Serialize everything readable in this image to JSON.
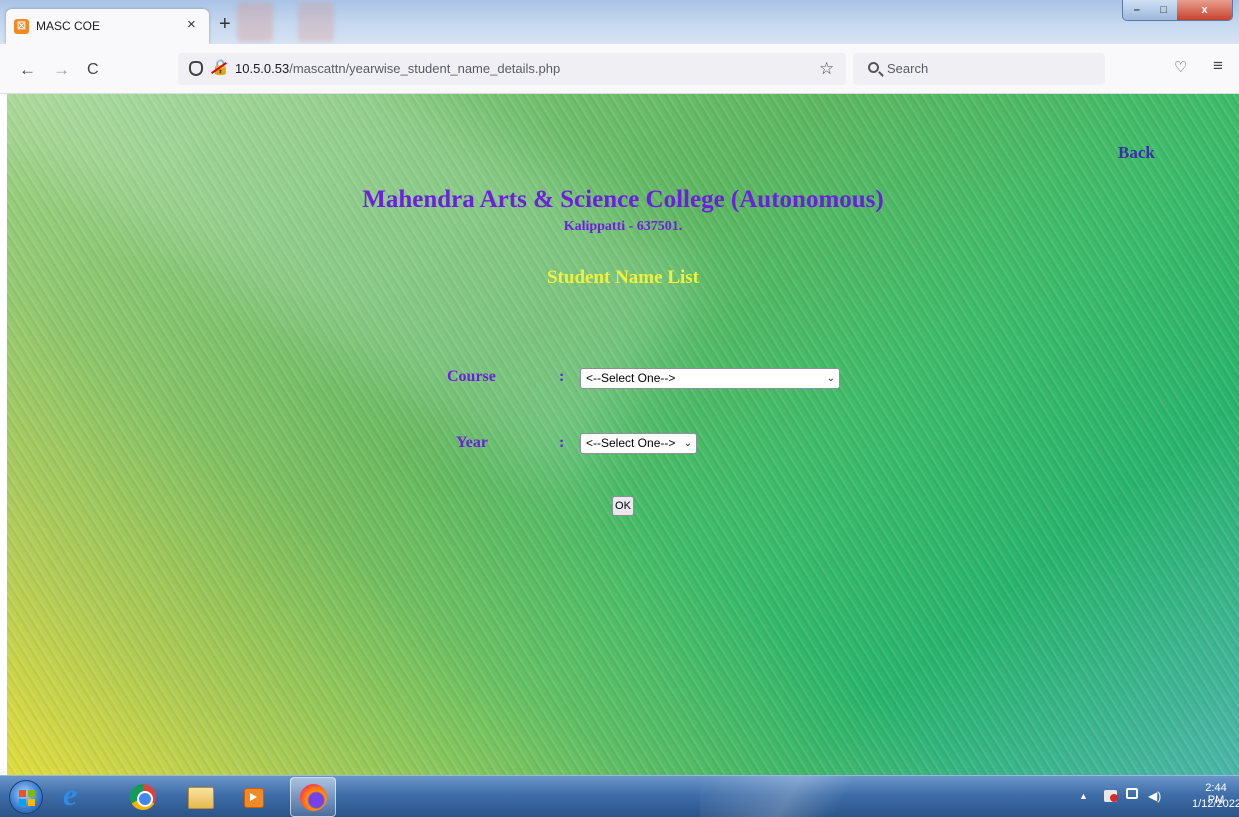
{
  "browser": {
    "tab": {
      "favicon_text": "☒",
      "title": "MASC COE",
      "close_symbol": "×"
    },
    "new_tab_symbol": "+",
    "window_controls": {
      "minimize": "–",
      "maximize": "□",
      "close": "x"
    },
    "nav": {
      "back": "←",
      "forward": "→",
      "reload": "C"
    },
    "url": {
      "host": "10.5.0.53",
      "path": "/mascattn/yearwise_student_name_details.php"
    },
    "bookmark_symbol": "☆",
    "search_placeholder": "Search",
    "pocket_symbol": "♡",
    "menu_symbol": "≡"
  },
  "page": {
    "back_link": "Back",
    "college_name": "Mahendra Arts & Science College (Autonomous)",
    "college_address": "Kalippatti - 637501.",
    "heading": "Student Name List",
    "form": {
      "course": {
        "label": "Course",
        "colon": ":",
        "selected": "<--Select One-->"
      },
      "year": {
        "label": "Year",
        "colon": ":",
        "selected": "<--Select One-->"
      },
      "submit_label": "OK"
    },
    "colors": {
      "title": "#6d1fe0",
      "heading": "#f3f13a",
      "back_link": "#3a2fa6"
    }
  },
  "taskbar": {
    "pinned": [
      "start-orb",
      "internet-explorer-icon",
      "chrome-icon",
      "file-explorer-icon",
      "media-player-icon",
      "firefox-icon"
    ],
    "tray": {
      "show_hidden": "▲",
      "volume": "◀)"
    },
    "clock": {
      "time": "2:44 PM",
      "date": "1/12/2022"
    }
  }
}
